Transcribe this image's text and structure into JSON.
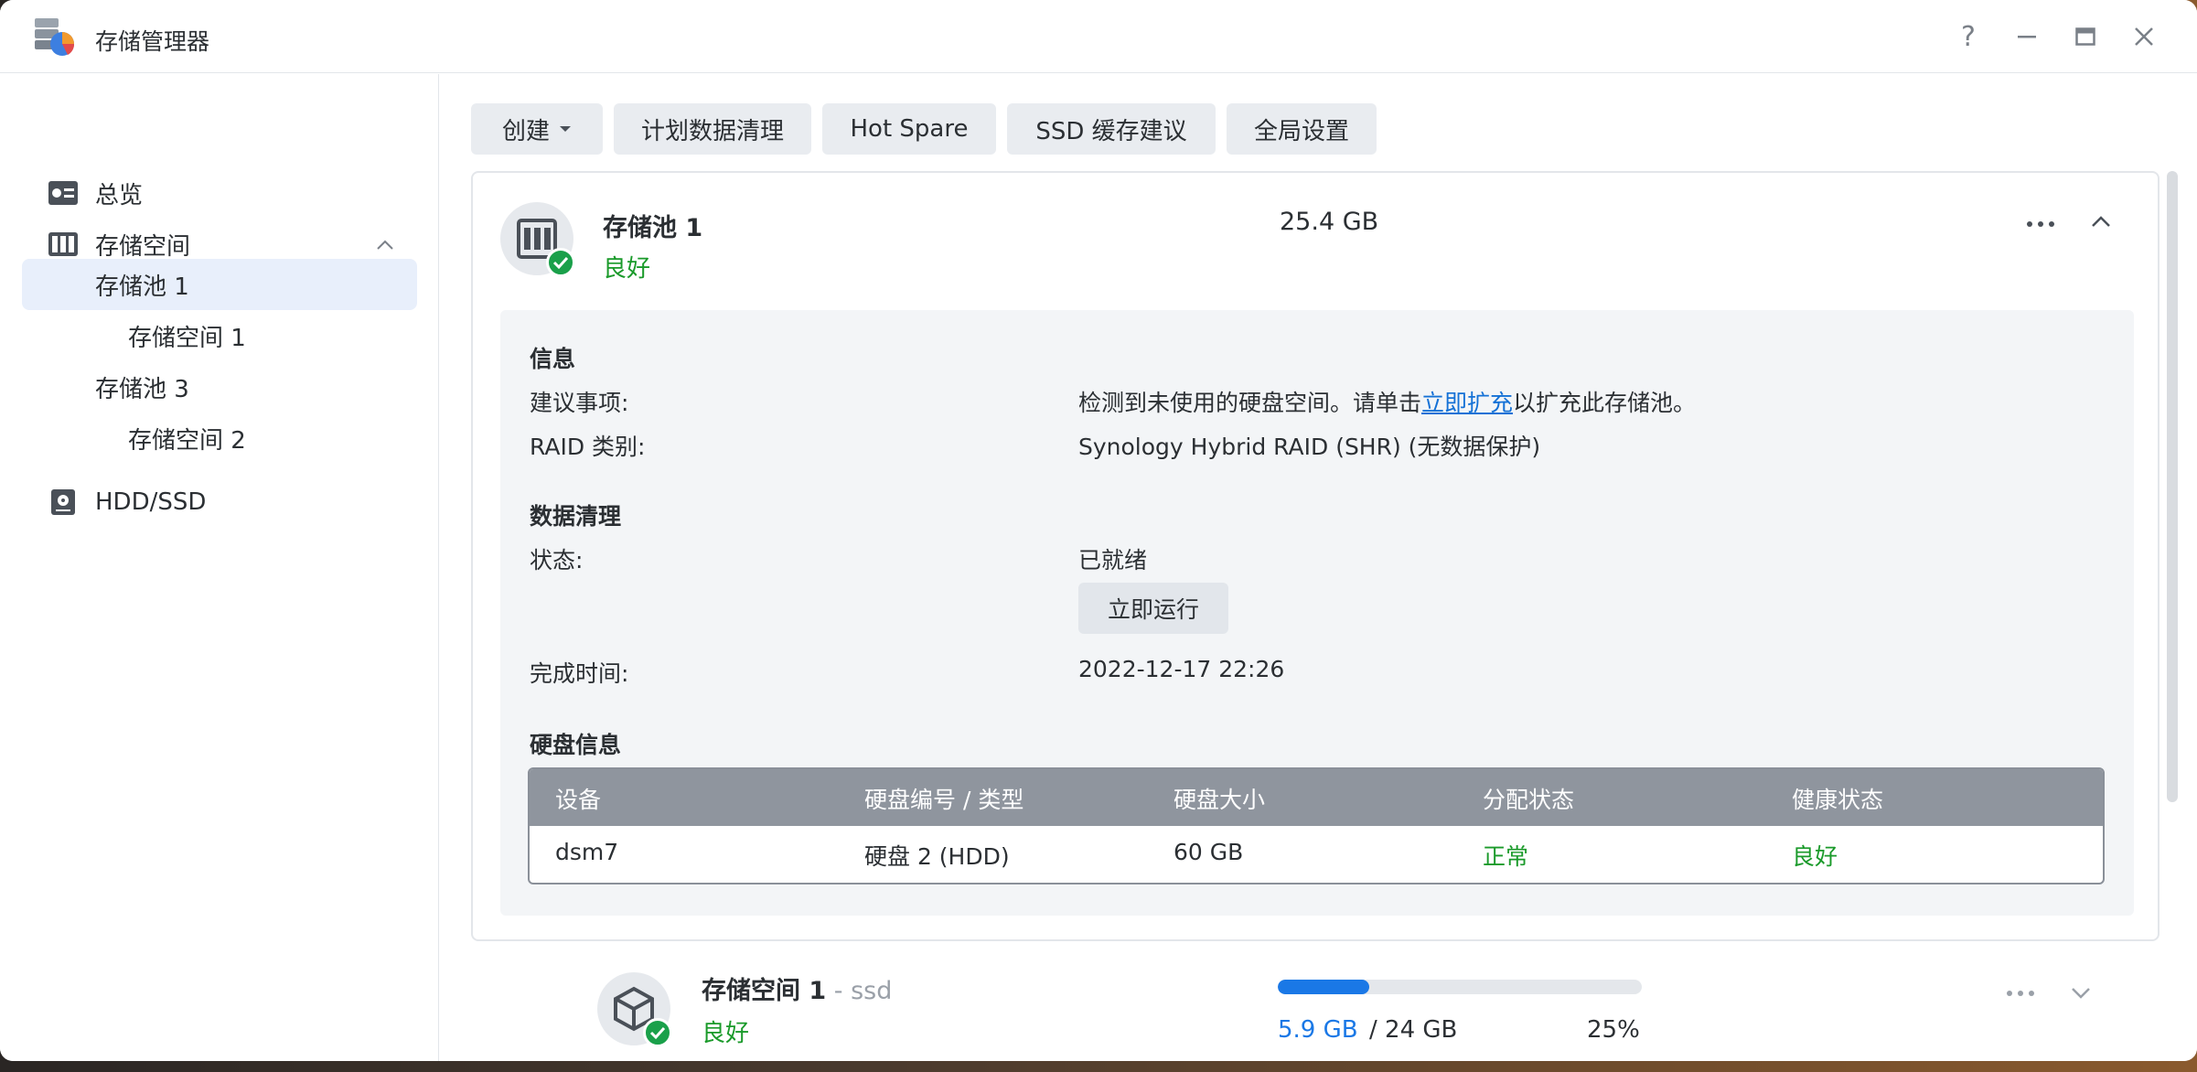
{
  "window": {
    "title": "存储管理器",
    "help": "?",
    "minimize": "—",
    "maximize": "▭",
    "close": "✕"
  },
  "sidebar": {
    "items": [
      {
        "label": "总览",
        "icon": "overview-icon"
      },
      {
        "label": "存储空间",
        "icon": "storage-icon"
      },
      {
        "label": "存储池 1"
      },
      {
        "label": "存储空间 1"
      },
      {
        "label": "存储池 3"
      },
      {
        "label": "存储空间 2"
      },
      {
        "label": "HDD/SSD",
        "icon": "hdd-icon"
      }
    ]
  },
  "toolbar": {
    "create": "创建",
    "scrub_schedule": "计划数据清理",
    "hot_spare": "Hot Spare",
    "ssd_cache": "SSD 缓存建议",
    "global_settings": "全局设置"
  },
  "pool": {
    "title": "存储池 1",
    "status": "良好",
    "size": "25.4 GB",
    "info_heading": "信息",
    "suggestion_label": "建议事项:",
    "suggestion_pre": "检测到未使用的硬盘空间。请单击",
    "suggestion_link": "立即扩充",
    "suggestion_post": "以扩充此存储池。",
    "raid_label": "RAID 类别:",
    "raid_value": "Synology Hybrid RAID (SHR) (无数据保护)",
    "scrub_heading": "数据清理",
    "state_label": "状态:",
    "state_value": "已就绪",
    "run_now": "立即运行",
    "finish_label": "完成时间:",
    "finish_value": "2022-12-17 22:26",
    "disk_heading": "硬盘信息",
    "table": {
      "headers": [
        "设备",
        "硬盘编号 / 类型",
        "硬盘大小",
        "分配状态",
        "健康状态"
      ],
      "rows": [
        [
          "dsm7",
          "硬盘 2 (HDD)",
          "60 GB",
          "正常",
          "良好"
        ]
      ]
    }
  },
  "volume": {
    "title": "存储空间 1",
    "separator": " - ",
    "subtitle": "ssd",
    "status": "良好",
    "used": "5.9 GB",
    "total": " / 24 GB",
    "percent": "25%",
    "usage_fraction": 0.25
  },
  "colors": {
    "accent": "#1a78e6",
    "good": "#1a9a2a",
    "table_header": "#8f959e",
    "selected": "#e8effb"
  }
}
